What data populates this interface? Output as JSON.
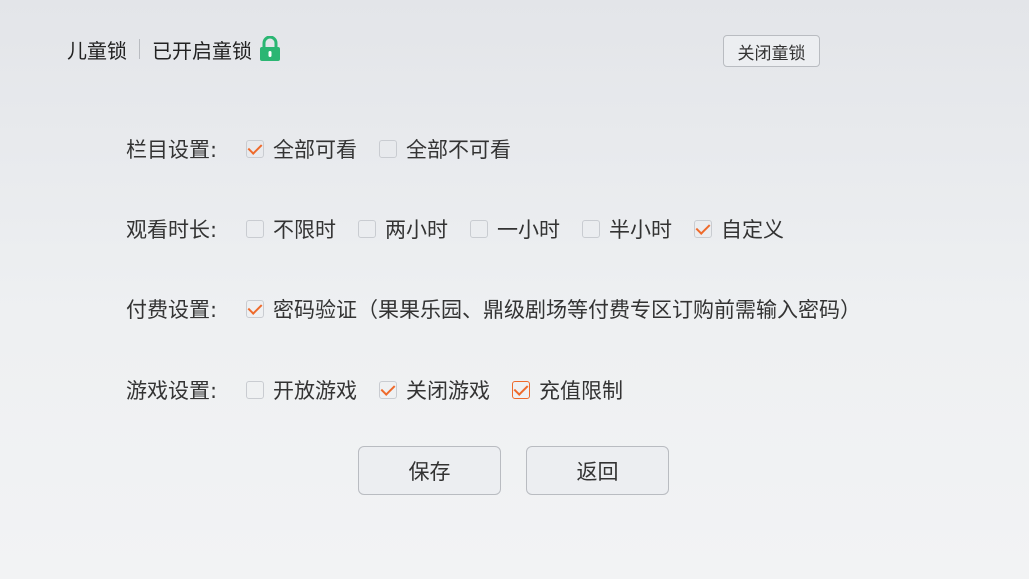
{
  "header": {
    "title": "儿童锁",
    "status": "已开启童锁"
  },
  "top_button": "关闭童锁",
  "rows": [
    {
      "label": "栏目设置:",
      "options": [
        {
          "text": "全部可看",
          "checked": true
        },
        {
          "text": "全部不可看",
          "checked": false
        }
      ]
    },
    {
      "label": "观看时长:",
      "options": [
        {
          "text": "不限时",
          "checked": false
        },
        {
          "text": "两小时",
          "checked": false
        },
        {
          "text": "一小时",
          "checked": false
        },
        {
          "text": "半小时",
          "checked": false
        },
        {
          "text": "自定义",
          "checked": true
        }
      ]
    },
    {
      "label": "付费设置:",
      "options": [
        {
          "text": "密码验证（果果乐园、鼎级剧场等付费专区订购前需输入密码）",
          "checked": true
        }
      ]
    },
    {
      "label": "游戏设置:",
      "options": [
        {
          "text": "开放游戏",
          "checked": false
        },
        {
          "text": "关闭游戏",
          "checked": true
        },
        {
          "text": "充值限制",
          "checked": true,
          "focused": true
        }
      ]
    }
  ],
  "buttons": {
    "save": "保存",
    "back": "返回"
  },
  "colors": {
    "accent": "#ee6a2b",
    "lock_green": "#2bb673"
  },
  "icons": {
    "lock": "lock-icon"
  }
}
